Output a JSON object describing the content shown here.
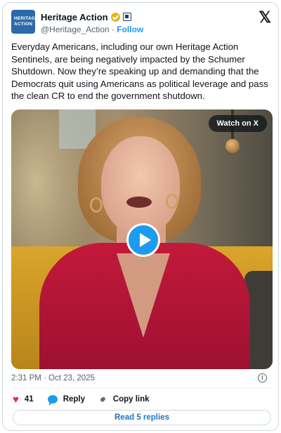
{
  "author": {
    "name": "Heritage Action",
    "handle": "@Heritage_Action",
    "separator": "·",
    "follow_label": "Follow",
    "avatar_text_line1": "HERITAGE",
    "avatar_text_line2": "ACTION"
  },
  "tweet": {
    "text": "Everyday Americans, including our own Heritage Action Sentinels, are being negatively impacted by the Schumer Shutdown. Now they’re speaking up and demanding that the Democrats quit using Americans as political leverage and pass the clean CR to end the government shutdown."
  },
  "video": {
    "watch_label": "Watch on X"
  },
  "meta": {
    "timestamp": "2:31 PM · Oct 23, 2025"
  },
  "actions": {
    "likes": "41",
    "reply_label": "Reply",
    "copy_label": "Copy link"
  },
  "footer": {
    "read_replies_label": "Read 5 replies"
  },
  "icons": {
    "x_logo": "𝕏",
    "heart": "♥",
    "info": "i",
    "link": "⚭"
  },
  "colors": {
    "accent": "#1d9bf0",
    "like": "#f91880",
    "verified": "#e2b719"
  }
}
